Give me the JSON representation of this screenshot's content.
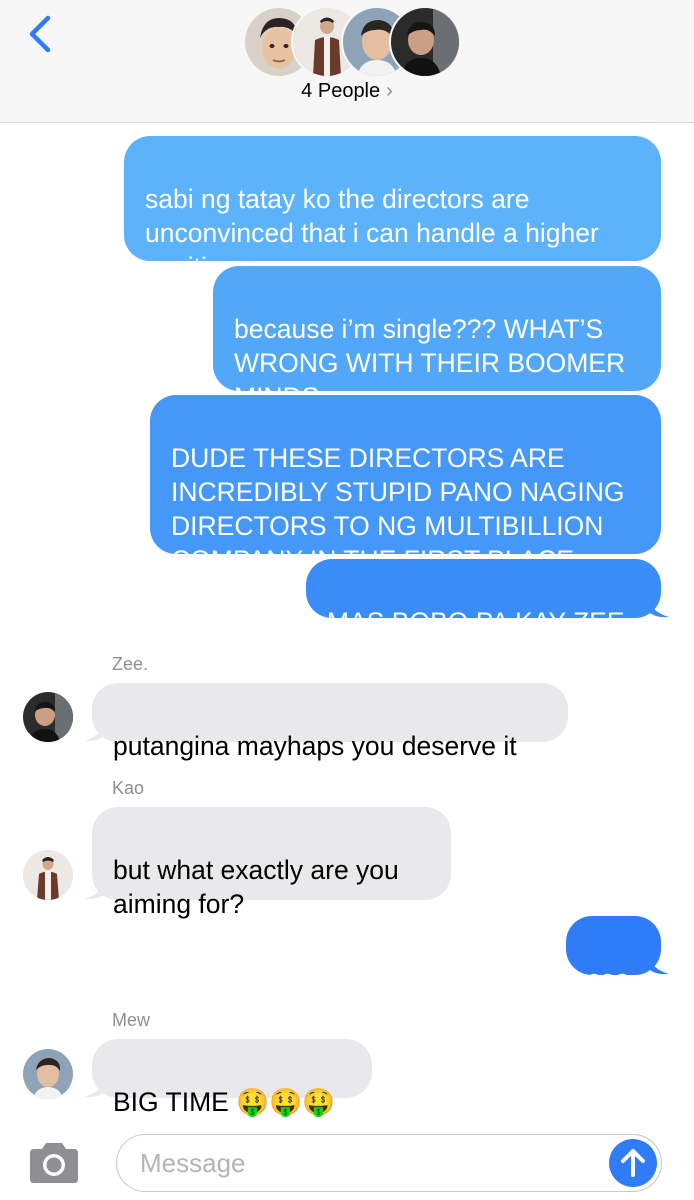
{
  "header": {
    "people_label": "4 People",
    "chevron": "›",
    "avatars": [
      "avatar-person-1",
      "avatar-person-2",
      "avatar-person-3",
      "avatar-person-4"
    ]
  },
  "messages": [
    {
      "from": "me",
      "text": "sabi ng tatay ko the directors are\nunconvinced that i can handle a higher\nposition"
    },
    {
      "from": "me",
      "text": "because i’m single??? WHAT’S\nWRONG WITH THEIR BOOMER\nMINDS"
    },
    {
      "from": "me",
      "text": "DUDE THESE DIRECTORS ARE\nINCREDIBLY STUPID PANO NAGING\nDIRECTORS TO NG MULTIBILLION\nCOMPANY IN THE FIRST PLACE"
    },
    {
      "from": "me",
      "text": "MAS BOBO PA KAY ZEE"
    },
    {
      "from": "Zee.",
      "sender_label": "Zee.",
      "text": "putangina mayhaps you deserve it"
    },
    {
      "from": "Kao",
      "sender_label": "Kao",
      "text": "but what exactly are you\naiming for?"
    },
    {
      "from": "me",
      "text": "ceo"
    },
    {
      "from": "Mew",
      "sender_label": "Mew",
      "text": "BIG TIME 🤑🤑🤑"
    }
  ],
  "input": {
    "placeholder": "Message"
  },
  "colors": {
    "bubble_out_light": "#5cb3fb",
    "bubble_out_dark": "#2f7cf6",
    "bubble_in": "#e9e9eb",
    "accent": "#2f7cf6"
  }
}
